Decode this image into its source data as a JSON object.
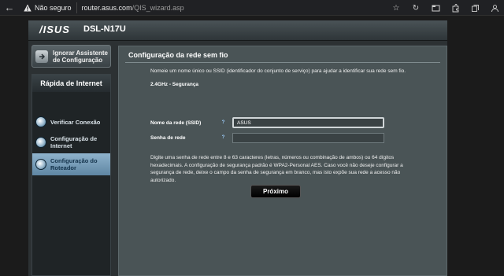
{
  "browser": {
    "security_label": "Não seguro",
    "url_host": "router.asus.com",
    "url_path": "/QIS_wizard.asp",
    "icons": [
      "back-arrow-icon",
      "warning-icon",
      "star-icon",
      "refresh-icon",
      "tab-icon",
      "extensions-icon",
      "collections-icon",
      "profile-icon"
    ]
  },
  "router": {
    "brand": "/ISUS",
    "model": "DSL-N17U"
  },
  "sidebar": {
    "skip_label": "Ignorar Assistente de Configuração",
    "menu_title": "Rápida de Internet",
    "items": [
      {
        "label": "Verificar Conexão",
        "active": false
      },
      {
        "label": "Configuração de Internet",
        "active": false
      },
      {
        "label": "Configuração do Roteador",
        "active": true
      }
    ]
  },
  "panel": {
    "title": "Configuração da rede sem fio",
    "intro": "Nomeie um nome único ou SSID (identificador do conjunto de serviço) para ajudar a identificar sua rede sem fio.",
    "section": "2.4GHz - Segurança",
    "ssid_label": "Nome da rede (SSID)",
    "ssid_value": "ASUS",
    "password_label": "Senha de rede",
    "password_value": "",
    "description": "Digite uma senha de rede entre 8 e 63 caracteres (letras, números ou combinação de ambos) ou 64 dígitos hexadecimais. A configuração de segurança padrão é WPA2-Personal AES. Caso você não deseje configurar a segurança de rede, deixe o campo da senha de segurança em branco, mas isto expõe sua rede a acesso não autorizado.",
    "next_label": "Próximo"
  },
  "colors": {
    "active_menu": "#7fa5c0",
    "panel_bg": "#4a5456",
    "page_bg": "#1b1b1b"
  }
}
